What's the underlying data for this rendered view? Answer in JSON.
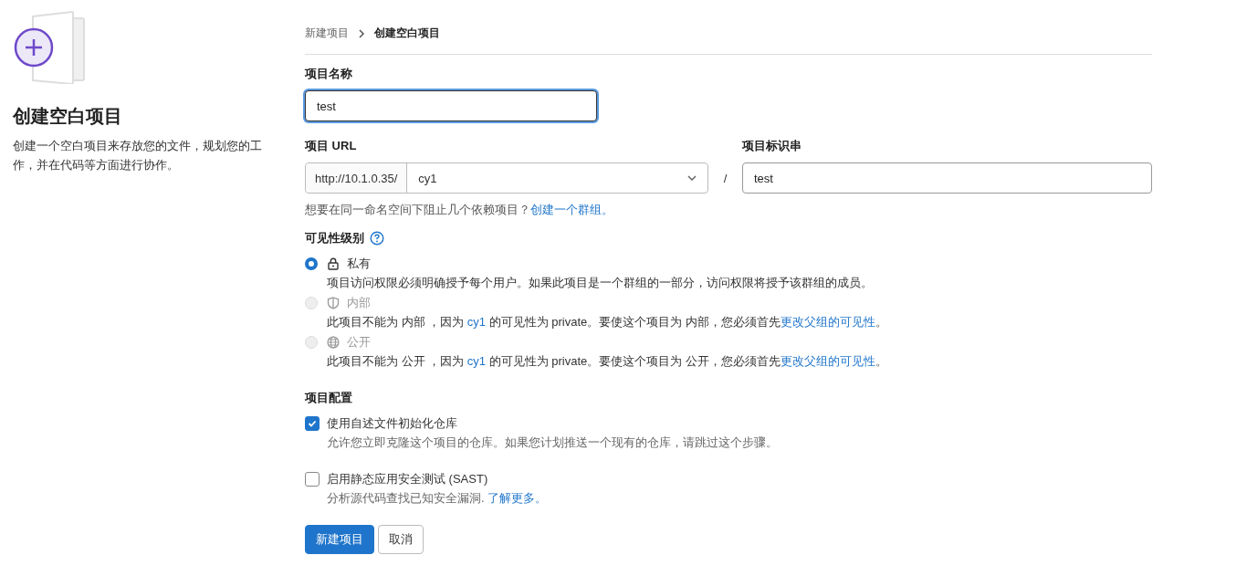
{
  "intro": {
    "title": "创建空白项目",
    "description": "创建一个空白项目来存放您的文件，规划您的工作，并在代码等方面进行协作。"
  },
  "breadcrumb": [
    {
      "label": "新建项目",
      "current": false
    },
    {
      "label": "创建空白项目",
      "current": true
    }
  ],
  "project_name": {
    "label": "项目名称",
    "value": "test"
  },
  "project_url": {
    "label": "项目 URL",
    "prefix": "http://10.1.0.35/",
    "namespace": "cy1",
    "separator": "/"
  },
  "project_slug": {
    "label": "项目标识串",
    "value": "test"
  },
  "url_hint": [
    {
      "kind": "text",
      "text": "想要在同一命名空间下阻止几个依赖项目？"
    },
    {
      "kind": "link",
      "text": "创建一个群组。"
    }
  ],
  "visibility": {
    "label": "可见性级别",
    "options": [
      {
        "kind": "private",
        "label": "私有",
        "selected": true,
        "disabled": false,
        "description": [
          {
            "kind": "text",
            "text": "项目访问权限必须明确授予每个用户。如果此项目是一个群组的一部分，访问权限将授予该群组的成员。"
          }
        ]
      },
      {
        "kind": "internal",
        "label": "内部",
        "selected": false,
        "disabled": true,
        "description": [
          {
            "kind": "text",
            "text": "此项目不能为 内部 ，因为 "
          },
          {
            "kind": "link",
            "text": "cy1"
          },
          {
            "kind": "text",
            "text": " 的可见性为 private。要使这个项目为 内部，您必须首先"
          },
          {
            "kind": "link",
            "text": "更改父组的可见性"
          },
          {
            "kind": "text",
            "text": "。"
          }
        ]
      },
      {
        "kind": "public",
        "label": "公开",
        "selected": false,
        "disabled": true,
        "description": [
          {
            "kind": "text",
            "text": "此项目不能为 公开 ，因为 "
          },
          {
            "kind": "link",
            "text": "cy1"
          },
          {
            "kind": "text",
            "text": " 的可见性为 private。要使这个项目为 公开，您必须首先"
          },
          {
            "kind": "link",
            "text": "更改父组的可见性"
          },
          {
            "kind": "text",
            "text": "。"
          }
        ]
      }
    ]
  },
  "configuration": {
    "label": "项目配置",
    "options": [
      {
        "label": "使用自述文件初始化仓库",
        "checked": true,
        "description": [
          {
            "kind": "text",
            "text": "允许您立即克隆这个项目的仓库。如果您计划推送一个现有的仓库，请跳过这个步骤。"
          }
        ]
      },
      {
        "label": "启用静态应用安全测试 (SAST)",
        "checked": false,
        "description": [
          {
            "kind": "text",
            "text": "分析源代码查找已知安全漏洞. "
          },
          {
            "kind": "link",
            "text": "了解更多。"
          }
        ]
      }
    ]
  },
  "buttons": [
    {
      "kind": "primary",
      "label": "新建项目"
    },
    {
      "kind": "secondary",
      "label": "取消"
    }
  ]
}
